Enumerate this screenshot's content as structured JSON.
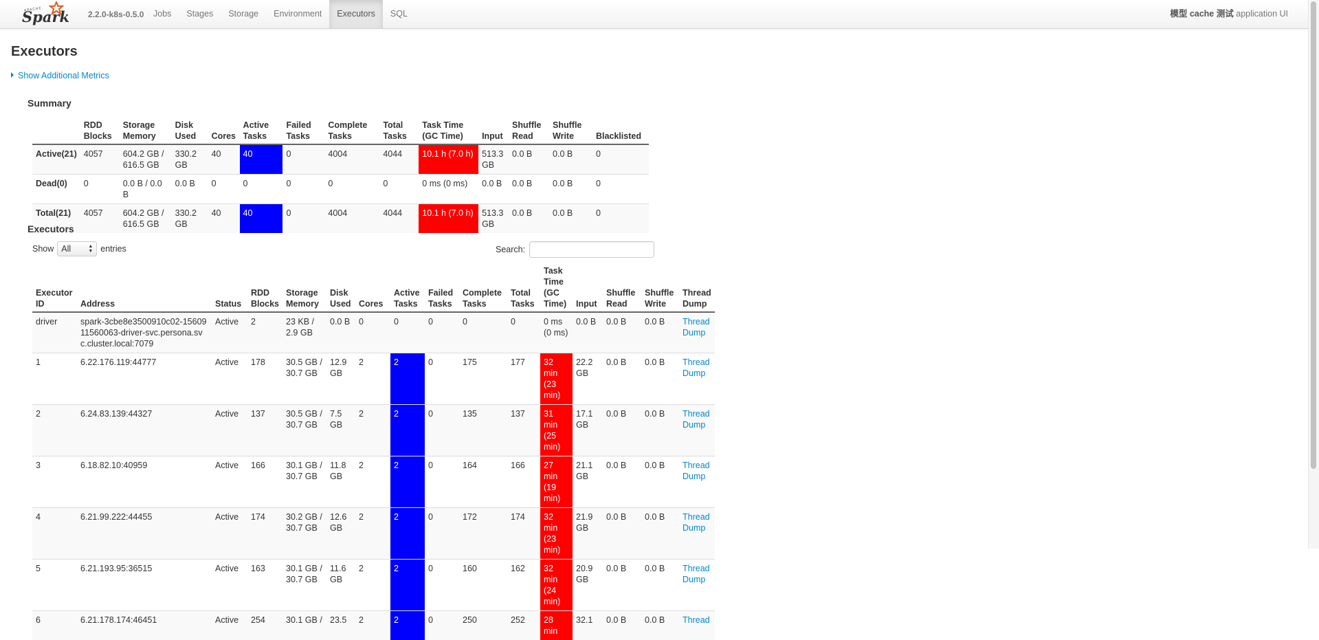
{
  "navbar": {
    "version": "2.2.0-k8s-0.5.0",
    "tabs": [
      "Jobs",
      "Stages",
      "Storage",
      "Environment",
      "Executors",
      "SQL"
    ],
    "active_tab": "Executors",
    "app_title_prefix": "模型",
    "app_title_bold": "cache",
    "app_title_mid": "测试",
    "app_title_suffix": "application UI"
  },
  "page": {
    "title": "Executors",
    "show_metrics": "Show Additional Metrics"
  },
  "summary": {
    "title": "Summary",
    "headers": [
      "",
      "RDD Blocks",
      "Storage Memory",
      "Disk Used",
      "Cores",
      "Active Tasks",
      "Failed Tasks",
      "Complete Tasks",
      "Total Tasks",
      "Task Time (GC Time)",
      "Input",
      "Shuffle Read",
      "Shuffle Write",
      "Blacklisted"
    ],
    "rows": [
      [
        "Active(21)",
        "4057",
        "604.2 GB / 616.5 GB",
        "330.2 GB",
        "40",
        "40",
        "0",
        "4004",
        "4044",
        "10.1 h (7.0 h)",
        "513.3 GB",
        "0.0 B",
        "0.0 B",
        "0"
      ],
      [
        "Dead(0)",
        "0",
        "0.0 B / 0.0 B",
        "0.0 B",
        "0",
        "0",
        "0",
        "0",
        "0",
        "0 ms (0 ms)",
        "0.0 B",
        "0.0 B",
        "0.0 B",
        "0"
      ],
      [
        "Total(21)",
        "4057",
        "604.2 GB / 616.5 GB",
        "330.2 GB",
        "40",
        "40",
        "0",
        "4004",
        "4044",
        "10.1 h (7.0 h)",
        "513.3 GB",
        "0.0 B",
        "0.0 B",
        "0"
      ]
    ]
  },
  "executors": {
    "title": "Executors",
    "show_label": "Show",
    "entries_label": "entries",
    "length_value": "All",
    "search_label": "Search:",
    "search_value": "",
    "headers": [
      "Executor ID",
      "Address",
      "Status",
      "RDD Blocks",
      "Storage Memory",
      "Disk Used",
      "Cores",
      "Active Tasks",
      "Failed Tasks",
      "Complete Tasks",
      "Total Tasks",
      "Task Time (GC Time)",
      "Input",
      "Shuffle Read",
      "Shuffle Write",
      "Thread Dump"
    ],
    "rows": [
      [
        "driver",
        "spark-3cbe8e3500910c02-1560911560063-driver-svc.persona.svc.cluster.local:7079",
        "Active",
        "2",
        "23 KB / 2.9 GB",
        "0.0 B",
        "0",
        "0",
        "0",
        "0",
        "0",
        "0 ms (0 ms)",
        "0.0 B",
        "0.0 B",
        "0.0 B",
        "Thread Dump"
      ],
      [
        "1",
        "6.22.176.119:44777",
        "Active",
        "178",
        "30.5 GB / 30.7 GB",
        "12.9 GB",
        "2",
        "2",
        "0",
        "175",
        "177",
        "32 min (23 min)",
        "22.2 GB",
        "0.0 B",
        "0.0 B",
        "Thread Dump"
      ],
      [
        "2",
        "6.24.83.139:44327",
        "Active",
        "137",
        "30.5 GB / 30.7 GB",
        "7.5 GB",
        "2",
        "2",
        "0",
        "135",
        "137",
        "31 min (25 min)",
        "17.1 GB",
        "0.0 B",
        "0.0 B",
        "Thread Dump"
      ],
      [
        "3",
        "6.18.82.10:40959",
        "Active",
        "166",
        "30.1 GB / 30.7 GB",
        "11.8 GB",
        "2",
        "2",
        "0",
        "164",
        "166",
        "27 min (19 min)",
        "21.1 GB",
        "0.0 B",
        "0.0 B",
        "Thread Dump"
      ],
      [
        "4",
        "6.21.99.222:44455",
        "Active",
        "174",
        "30.2 GB / 30.7 GB",
        "12.6 GB",
        "2",
        "2",
        "0",
        "172",
        "174",
        "32 min (23 min)",
        "21.9 GB",
        "0.0 B",
        "0.0 B",
        "Thread Dump"
      ],
      [
        "5",
        "6.21.193.95:36515",
        "Active",
        "163",
        "30.1 GB / 30.7 GB",
        "11.6 GB",
        "2",
        "2",
        "0",
        "160",
        "162",
        "32 min (24 min)",
        "20.9 GB",
        "0.0 B",
        "0.0 B",
        "Thread Dump"
      ],
      [
        "6",
        "6.21.178.174:46451",
        "Active",
        "254",
        "30.1 GB /",
        "23.5",
        "2",
        "2",
        "0",
        "250",
        "252",
        "28 min",
        "32.1",
        "0.0 B",
        "0.0 B",
        "Thread"
      ]
    ]
  },
  "colors": {
    "active_tasks": "#0000ff",
    "task_time": "#ff0000",
    "link": "#0088cc"
  }
}
